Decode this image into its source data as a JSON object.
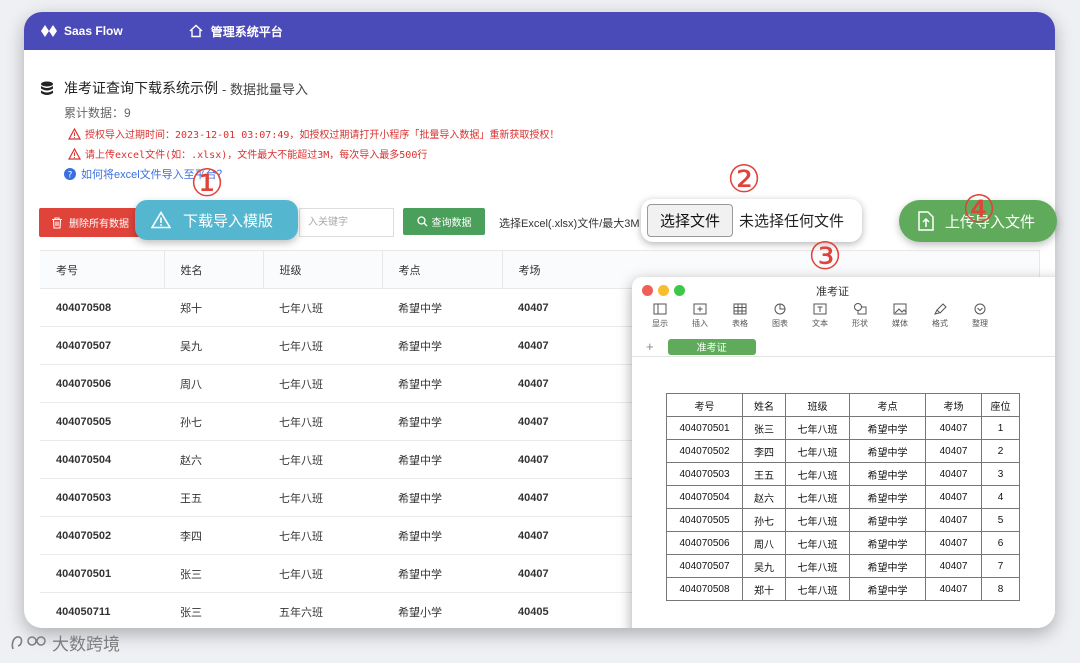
{
  "topbar": {
    "brand": "Saas Flow",
    "home_label": "管理系统平台"
  },
  "header": {
    "title": "准考证查询下载系统示例",
    "subtitle": "- 数据批量导入",
    "count": "累计数据：9",
    "warning_1": "授权导入过期时间：2023-12-01 03:07:49，如授权过期请打开小程序「批量导入数据」重新获取授权！",
    "warning_2": "请上传excel文件(如：.xlsx)，文件最大不能超过3M，每次导入最多500行",
    "help_link": "如何将excel文件导入至平台？"
  },
  "toolbar": {
    "delete_all": "删除所有数据",
    "search_placeholder": "入关键字",
    "query": "查询数据",
    "upload_hint": "选择Excel(.xlsx)文件/最大3M"
  },
  "callouts": {
    "download_template": "下载导入模版",
    "choose_file": "选择文件",
    "no_file": "未选择任何文件",
    "upload_file": "上传导入文件"
  },
  "step_numbers": [
    "①",
    "②",
    "③",
    "④"
  ],
  "table": {
    "columns": [
      "考号",
      "姓名",
      "班级",
      "考点",
      "考场"
    ],
    "rows": [
      [
        "404070508",
        "郑十",
        "七年八班",
        "希望中学",
        "40407"
      ],
      [
        "404070507",
        "吴九",
        "七年八班",
        "希望中学",
        "40407"
      ],
      [
        "404070506",
        "周八",
        "七年八班",
        "希望中学",
        "40407"
      ],
      [
        "404070505",
        "孙七",
        "七年八班",
        "希望中学",
        "40407"
      ],
      [
        "404070504",
        "赵六",
        "七年八班",
        "希望中学",
        "40407"
      ],
      [
        "404070503",
        "王五",
        "七年八班",
        "希望中学",
        "40407"
      ],
      [
        "404070502",
        "李四",
        "七年八班",
        "希望中学",
        "40407"
      ],
      [
        "404070501",
        "张三",
        "七年八班",
        "希望中学",
        "40407"
      ],
      [
        "404050711",
        "张三",
        "五年六班",
        "希望小学",
        "40405"
      ]
    ]
  },
  "numbers_app": {
    "title": "准考证",
    "sheet_tab": "准考证",
    "tools": [
      "显示",
      "插入",
      "表格",
      "图表",
      "文本",
      "形状",
      "媒体",
      "格式",
      "整理"
    ],
    "columns": [
      "考号",
      "姓名",
      "班级",
      "考点",
      "考场",
      "座位"
    ],
    "rows": [
      [
        "404070501",
        "张三",
        "七年八班",
        "希望中学",
        "40407",
        "1"
      ],
      [
        "404070502",
        "李四",
        "七年八班",
        "希望中学",
        "40407",
        "2"
      ],
      [
        "404070503",
        "王五",
        "七年八班",
        "希望中学",
        "40407",
        "3"
      ],
      [
        "404070504",
        "赵六",
        "七年八班",
        "希望中学",
        "40407",
        "4"
      ],
      [
        "404070505",
        "孙七",
        "七年八班",
        "希望中学",
        "40407",
        "5"
      ],
      [
        "404070506",
        "周八",
        "七年八班",
        "希望中学",
        "40407",
        "6"
      ],
      [
        "404070507",
        "吴九",
        "七年八班",
        "希望中学",
        "40407",
        "7"
      ],
      [
        "404070508",
        "郑十",
        "七年八班",
        "希望中学",
        "40407",
        "8"
      ]
    ]
  },
  "watermark": "大数跨境",
  "colors": {
    "topbar": "#4a4ab8",
    "danger": "#e0433a",
    "success": "#4aa05a",
    "callout_blue": "#55b6cf",
    "link": "#3a6fe0"
  }
}
